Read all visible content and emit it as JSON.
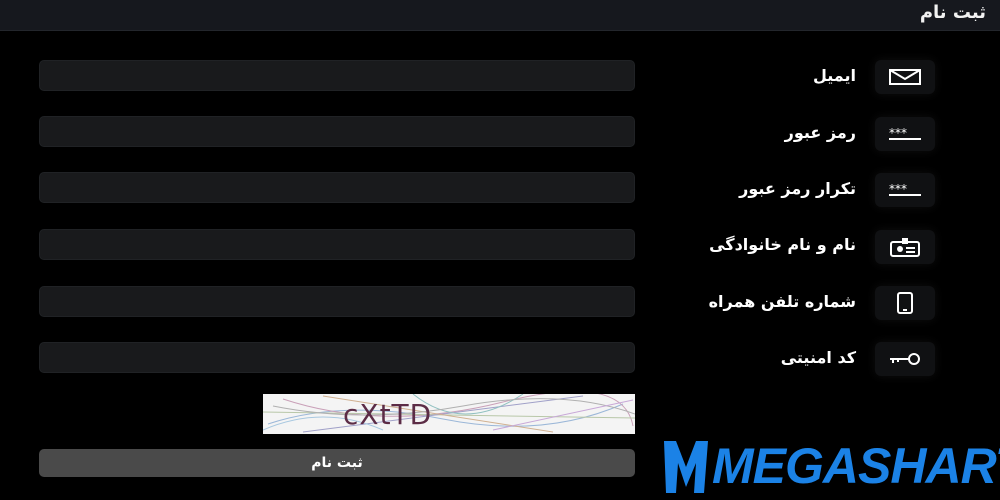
{
  "header": {
    "title": "ثبت نام"
  },
  "form": {
    "fields": [
      {
        "label": "ایمیل",
        "icon": "envelope-icon",
        "value": ""
      },
      {
        "label": "رمز عبور",
        "icon": "password-dots-icon",
        "value": ""
      },
      {
        "label": "تکرار رمز عبور",
        "icon": "password-dots-icon",
        "value": ""
      },
      {
        "label": "نام و نام خانوادگی",
        "icon": "id-card-icon",
        "value": ""
      },
      {
        "label": "شماره تلفن همراه",
        "icon": "mobile-phone-icon",
        "value": ""
      },
      {
        "label": "کد امنیتی",
        "icon": "key-icon",
        "value": ""
      }
    ],
    "captcha_text": "cXtTD",
    "submit_label": "ثبت نام"
  },
  "watermark": {
    "text": "MEGASHART"
  },
  "colors": {
    "background": "#000000",
    "header_bg": "#16181e",
    "input_bg": "#191a1c",
    "button_bg": "#4a4a4a",
    "watermark_blue": "#1b82e6"
  }
}
